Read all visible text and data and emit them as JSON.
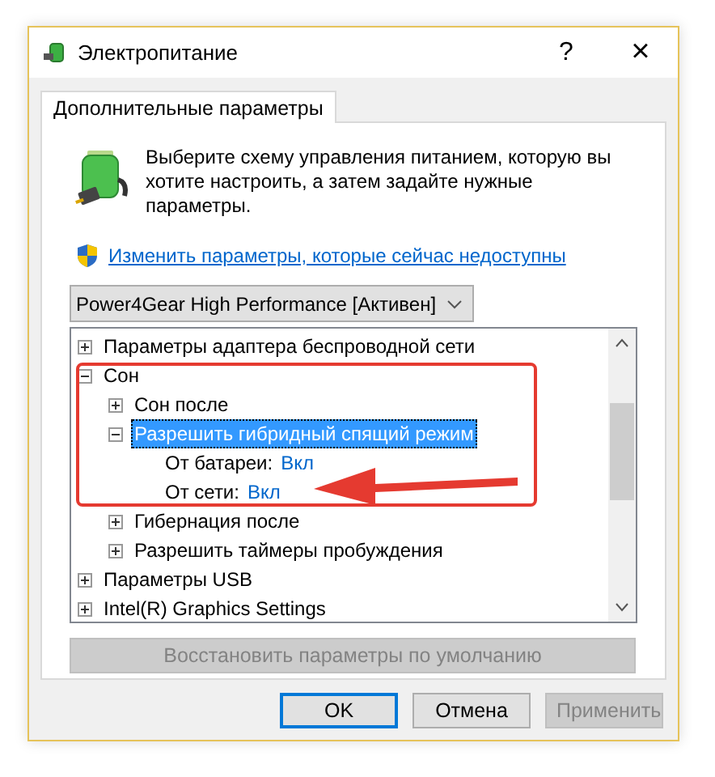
{
  "window": {
    "title": "Электропитание",
    "help_button": "?",
    "close_button": "×"
  },
  "tabs": [
    {
      "label": "Дополнительные параметры",
      "selected": true
    }
  ],
  "intro": "Выберите схему управления питанием, которую вы хотите настроить, а затем задайте нужные параметры.",
  "admin_link": "Изменить параметры, которые сейчас недоступны",
  "plan_dropdown": {
    "value": "Power4Gear High Performance [Активен]"
  },
  "tree": [
    {
      "kind": "group",
      "label": "Параметры адаптера беспроводной сети",
      "expanded": false,
      "selected": false
    },
    {
      "kind": "group",
      "label": "Сон",
      "expanded": true,
      "selected": false,
      "children": [
        {
          "kind": "group",
          "label": "Сон после",
          "expanded": false,
          "selected": false
        },
        {
          "kind": "group",
          "label": "Разрешить гибридный спящий режим",
          "expanded": true,
          "selected": true,
          "children": [
            {
              "kind": "setting",
              "label": "От батареи:",
              "value": "Вкл"
            },
            {
              "kind": "setting",
              "label": "От сети:",
              "value": "Вкл"
            }
          ]
        },
        {
          "kind": "group",
          "label": "Гибернация после",
          "expanded": false,
          "selected": false
        },
        {
          "kind": "group",
          "label": "Разрешить таймеры пробуждения",
          "expanded": false,
          "selected": false
        }
      ]
    },
    {
      "kind": "group",
      "label": "Параметры USB",
      "expanded": false,
      "selected": false
    },
    {
      "kind": "group",
      "label": "Intel(R) Graphics Settings",
      "expanded": false,
      "selected": false
    }
  ],
  "restore_button": {
    "label": "Восстановить параметры по умолчанию",
    "disabled": true
  },
  "buttons": [
    {
      "label": "OK",
      "disabled": false,
      "default": true
    },
    {
      "label": "Отмена",
      "disabled": false,
      "default": false
    },
    {
      "label": "Применить",
      "disabled": true,
      "default": false
    }
  ]
}
